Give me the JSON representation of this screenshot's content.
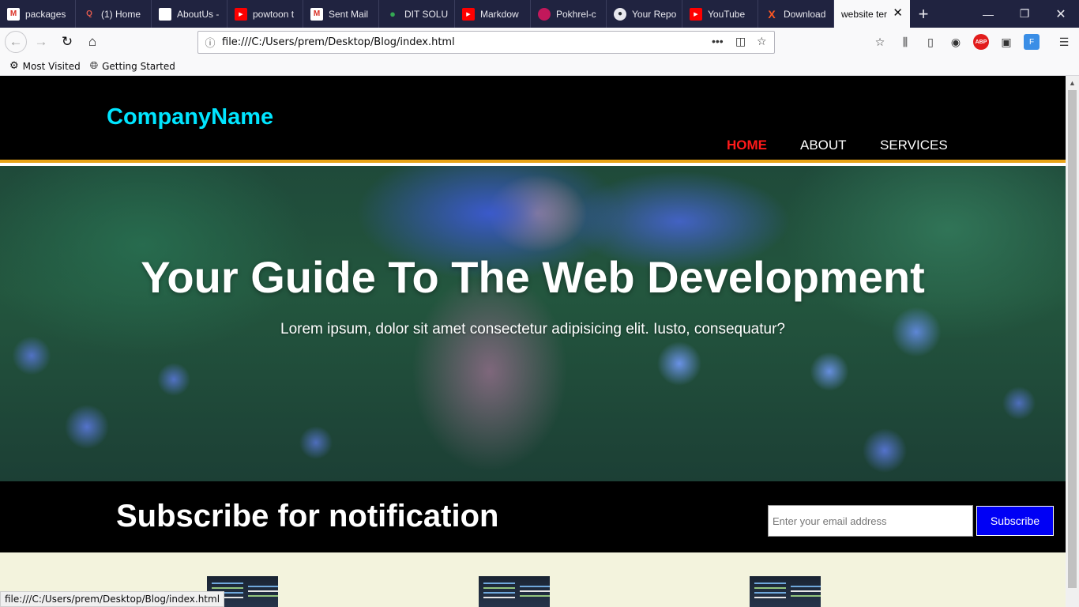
{
  "browser": {
    "tabs": [
      {
        "title": "packages",
        "icon": "gmail-icon",
        "color": "#d93025"
      },
      {
        "title": "(1) Home",
        "icon": "quora-icon",
        "color": "#b92b27"
      },
      {
        "title": "AboutUs -",
        "icon": "document-icon",
        "color": "#ffffff"
      },
      {
        "title": "powtoon t",
        "icon": "youtube-icon",
        "color": "#ff0000"
      },
      {
        "title": "Sent Mail",
        "icon": "gmail-icon",
        "color": "#d93025"
      },
      {
        "title": "DIT SOLU",
        "icon": "maps-icon",
        "color": "#34a853"
      },
      {
        "title": "Markdow",
        "icon": "youtube-icon",
        "color": "#ff0000"
      },
      {
        "title": "Pokhrel-c",
        "icon": "app-icon",
        "color": "#c2185b"
      },
      {
        "title": "Your Repo",
        "icon": "github-icon",
        "color": "#24292e"
      },
      {
        "title": "YouTube",
        "icon": "youtube-icon",
        "color": "#ff0000"
      },
      {
        "title": "Download",
        "icon": "x-icon",
        "color": "#ff5722"
      }
    ],
    "active_tab": {
      "title": "website ter"
    },
    "url": "file:///C:/Users/prem/Desktop/Blog/index.html",
    "bookmarks": [
      {
        "label": "Most Visited"
      },
      {
        "label": "Getting Started"
      }
    ],
    "status_text": "file:///C:/Users/prem/Desktop/Blog/index.html"
  },
  "site": {
    "logo": "CompanyName",
    "nav": [
      {
        "label": "HOME",
        "active": true
      },
      {
        "label": "ABOUT",
        "active": false
      },
      {
        "label": "SERVICES",
        "active": false
      }
    ],
    "hero": {
      "title": "Your Guide To The Web Development",
      "subtitle": "Lorem ipsum, dolor sit amet consectetur adipisicing elit. Iusto, consequatur?"
    },
    "subscribe": {
      "title": "Subscribe for notification",
      "email_placeholder": "Enter your email address",
      "button_label": "Subscribe"
    },
    "colors": {
      "logo": "#00e5ff",
      "active_nav": "#ff1a1a",
      "header_border": "#e8a317",
      "subscribe_button": "#0000f5",
      "boxes_background": "#f3f3dd"
    }
  }
}
